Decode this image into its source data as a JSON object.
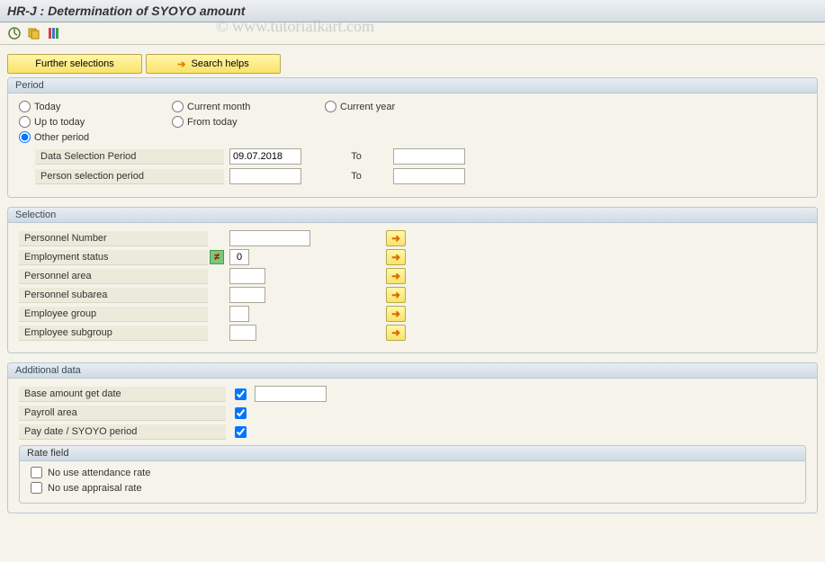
{
  "title": "HR-J : Determination of SYOYO amount",
  "watermark": "© www.tutorialkart.com",
  "toolbar_buttons": {
    "further_selections": "Further selections",
    "search_helps": "Search helps"
  },
  "period": {
    "legend": "Period",
    "radios": {
      "today": "Today",
      "current_month": "Current month",
      "current_year": "Current year",
      "up_to_today": "Up to today",
      "from_today": "From today",
      "other_period": "Other period"
    },
    "selected": "other_period",
    "data_selection_label": "Data Selection Period",
    "data_selection_value": "09.07.2018",
    "data_selection_to": "",
    "person_selection_label": "Person selection period",
    "person_selection_value": "",
    "person_selection_to": "",
    "to_label": "To"
  },
  "selection": {
    "legend": "Selection",
    "rows": [
      {
        "label": "Personnel Number",
        "value": "",
        "icon": ""
      },
      {
        "label": "Employment status",
        "value": "0",
        "icon": "not-equal"
      },
      {
        "label": "Personnel area",
        "value": "",
        "icon": ""
      },
      {
        "label": "Personnel subarea",
        "value": "",
        "icon": ""
      },
      {
        "label": "Employee group",
        "value": "",
        "icon": ""
      },
      {
        "label": "Employee subgroup",
        "value": "",
        "icon": ""
      }
    ]
  },
  "additional": {
    "legend": "Additional data",
    "rows": [
      {
        "label": "Base amount get date",
        "checked": true,
        "value": ""
      },
      {
        "label": "Payroll area",
        "checked": true,
        "value": ""
      },
      {
        "label": "Pay date / SYOYO period",
        "checked": true,
        "value": ""
      }
    ],
    "rate_field": {
      "legend": "Rate field",
      "no_use_attendance": "No use attendance rate",
      "no_use_appraisal": "No use appraisal rate"
    }
  }
}
